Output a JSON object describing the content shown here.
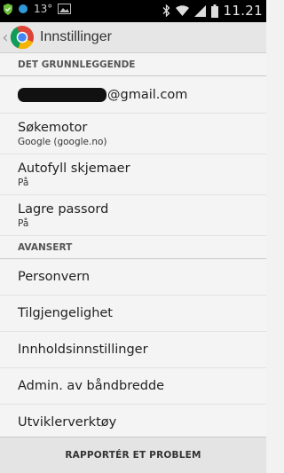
{
  "status_bar": {
    "temperature": "13°",
    "time": "11.21",
    "icons": [
      "shield-icon",
      "weather-icon",
      "image-icon",
      "bluetooth-icon",
      "wifi-icon",
      "signal-icon",
      "battery-icon"
    ]
  },
  "action_bar": {
    "title": "Innstillinger",
    "logo": "chrome-logo"
  },
  "sections": {
    "basics": {
      "header": "DET GRUNNLEGGENDE",
      "account_email_visible": "@gmail.com",
      "search_engine": {
        "title": "Søkemotor",
        "value": "Google (google.no)"
      },
      "autofill": {
        "title": "Autofyll skjemaer",
        "value": "På"
      },
      "passwords": {
        "title": "Lagre passord",
        "value": "På"
      }
    },
    "advanced": {
      "header": "AVANSERT",
      "items": [
        "Personvern",
        "Tilgjengelighet",
        "Innholdsinnstillinger",
        "Admin. av båndbredde",
        "Utviklerverktøy"
      ]
    }
  },
  "bottom_bar": {
    "button_label": "RAPPORTÉR ET PROBLEM"
  },
  "colors": {
    "status_bar": "#000000",
    "action_bar": "#e6e6e6",
    "content": "#f4f4f4",
    "bottom_bar": "#e4e4e4"
  }
}
